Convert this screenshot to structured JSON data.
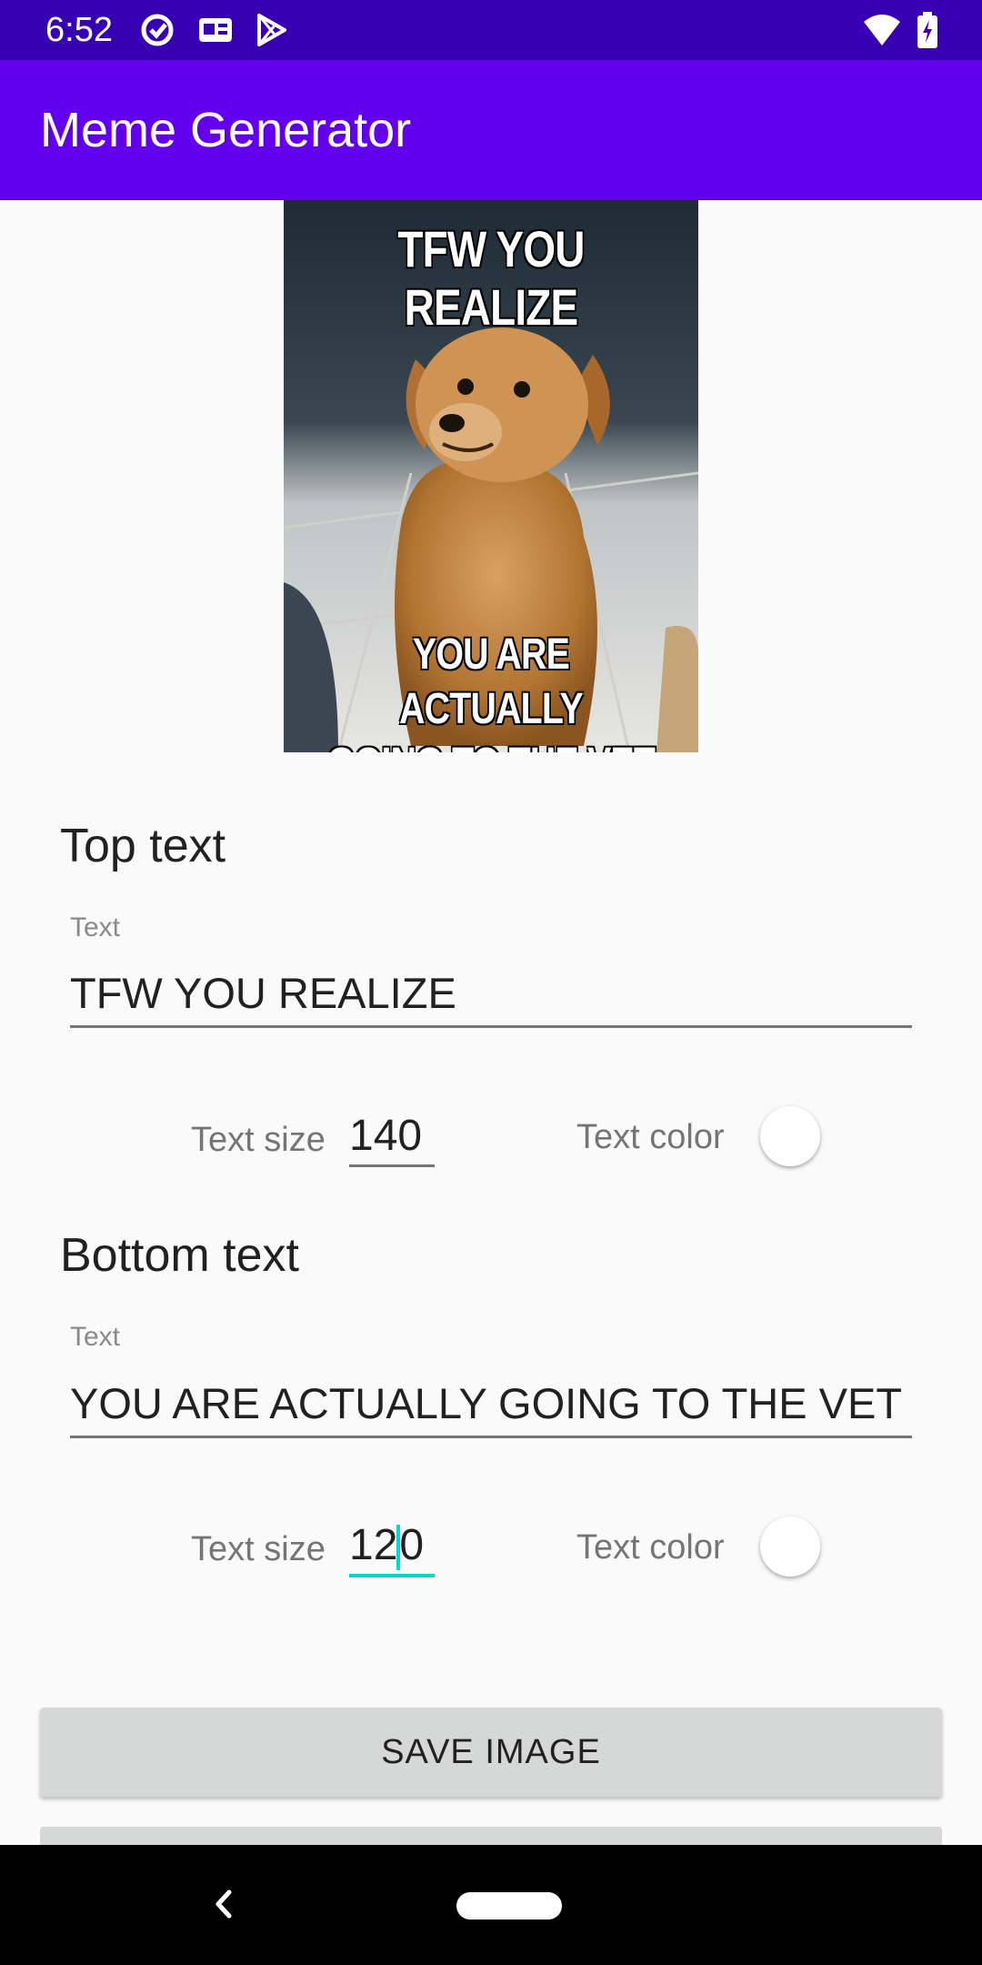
{
  "status_bar": {
    "time": "6:52",
    "left_icons": [
      "sync-icon",
      "news-icon",
      "play-store-icon"
    ],
    "right_icons": [
      "wifi-icon",
      "battery-icon"
    ]
  },
  "app_bar": {
    "title": "Meme Generator"
  },
  "meme_preview": {
    "top_text": "TFW YOU REALIZE",
    "bottom_text_line1": "YOU ARE ACTUALLY",
    "bottom_text_line2": "GOING TO THE VET"
  },
  "top_section": {
    "title": "Top text",
    "field_label": "Text",
    "field_value": "TFW YOU REALIZE",
    "size_label": "Text size",
    "size_value": "140",
    "color_label": "Text color",
    "text_color": "#ffffff"
  },
  "bottom_section": {
    "title": "Bottom text",
    "field_label": "Text",
    "field_value": "YOU ARE ACTUALLY GOING TO THE VET",
    "size_label": "Text size",
    "size_value_before_cursor": "12",
    "size_value_after_cursor": "0",
    "color_label": "Text color",
    "text_color": "#ffffff"
  },
  "actions": {
    "save_label": "SAVE IMAGE"
  },
  "colors": {
    "status_bar": "#3700b3",
    "app_bar": "#6200ee",
    "accent": "#03dac5",
    "button": "#d6d7d7"
  }
}
